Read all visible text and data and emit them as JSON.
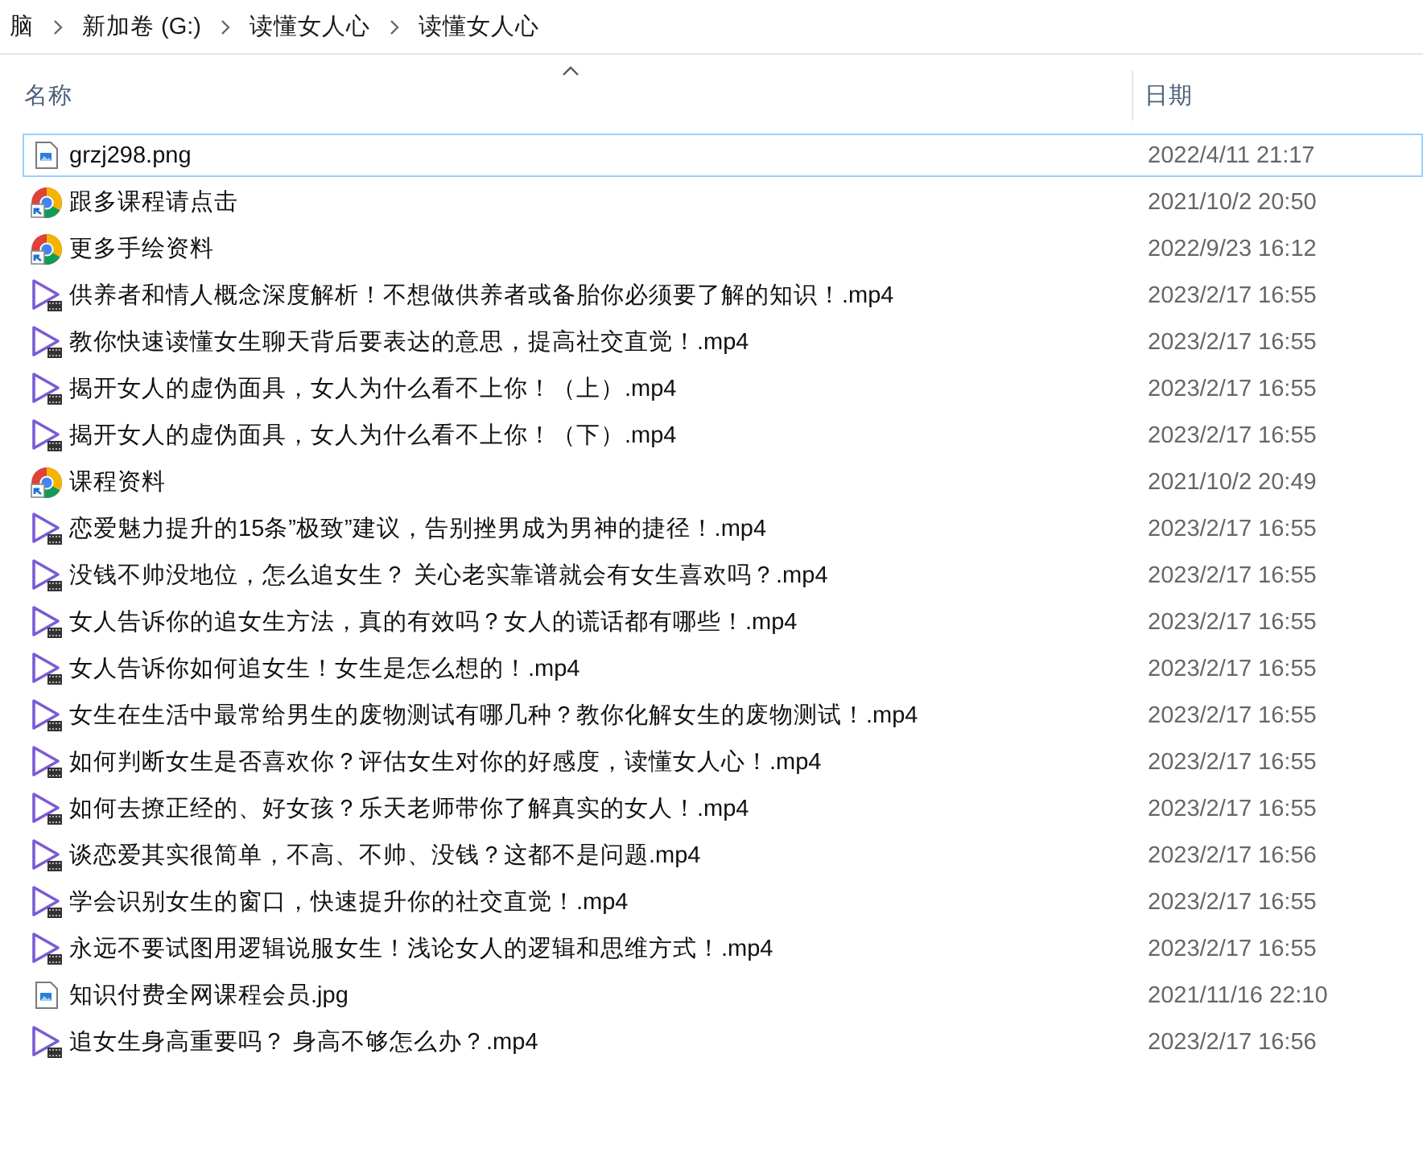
{
  "breadcrumb": [
    "脑",
    "新加卷 (G:)",
    "读懂女人心",
    "读懂女人心"
  ],
  "columns": [
    {
      "label": "名称",
      "sorted": true
    },
    {
      "label": "日期",
      "sorted": false
    }
  ],
  "files": [
    {
      "kind": "image",
      "name": "grzj298.png",
      "date": "2022/4/11 21:17",
      "focused": true
    },
    {
      "kind": "shortcut",
      "name": "跟多课程请点击",
      "date": "2021/10/2 20:50",
      "focused": false
    },
    {
      "kind": "shortcut",
      "name": "更多手绘资料",
      "date": "2022/9/23 16:12",
      "focused": false
    },
    {
      "kind": "video",
      "name": "供养者和情人概念深度解析！不想做供养者或备胎你必须要了解的知识！.mp4",
      "date": "2023/2/17 16:55",
      "focused": false
    },
    {
      "kind": "video",
      "name": "教你快速读懂女生聊天背后要表达的意思，提高社交直觉！.mp4",
      "date": "2023/2/17 16:55",
      "focused": false
    },
    {
      "kind": "video",
      "name": "揭开女人的虚伪面具，女人为什么看不上你！（上）.mp4",
      "date": "2023/2/17 16:55",
      "focused": false
    },
    {
      "kind": "video",
      "name": "揭开女人的虚伪面具，女人为什么看不上你！（下）.mp4",
      "date": "2023/2/17 16:55",
      "focused": false
    },
    {
      "kind": "shortcut",
      "name": "课程资料",
      "date": "2021/10/2 20:49",
      "focused": false
    },
    {
      "kind": "video",
      "name": "恋爱魅力提升的15条”极致”建议，告别挫男成为男神的捷径！.mp4",
      "date": "2023/2/17 16:55",
      "focused": false
    },
    {
      "kind": "video",
      "name": "没钱不帅没地位，怎么追女生？ 关心老实靠谱就会有女生喜欢吗？.mp4",
      "date": "2023/2/17 16:55",
      "focused": false
    },
    {
      "kind": "video",
      "name": "女人告诉你的追女生方法，真的有效吗？女人的谎话都有哪些！.mp4",
      "date": "2023/2/17 16:55",
      "focused": false
    },
    {
      "kind": "video",
      "name": "女人告诉你如何追女生！女生是怎么想的！.mp4",
      "date": "2023/2/17 16:55",
      "focused": false
    },
    {
      "kind": "video",
      "name": "女生在生活中最常给男生的废物测试有哪几种？教你化解女生的废物测试！.mp4",
      "date": "2023/2/17 16:55",
      "focused": false
    },
    {
      "kind": "video",
      "name": "如何判断女生是否喜欢你？评估女生对你的好感度，读懂女人心！.mp4",
      "date": "2023/2/17 16:55",
      "focused": false
    },
    {
      "kind": "video",
      "name": "如何去撩正经的、好女孩？乐天老师带你了解真实的女人！.mp4",
      "date": "2023/2/17 16:55",
      "focused": false
    },
    {
      "kind": "video",
      "name": "谈恋爱其实很简单，不高、不帅、没钱？这都不是问题.mp4",
      "date": "2023/2/17 16:56",
      "focused": false
    },
    {
      "kind": "video",
      "name": "学会识别女生的窗口，快速提升你的社交直觉！.mp4",
      "date": "2023/2/17 16:55",
      "focused": false
    },
    {
      "kind": "video",
      "name": "永远不要试图用逻辑说服女生！浅论女人的逻辑和思维方式！.mp4",
      "date": "2023/2/17 16:55",
      "focused": false
    },
    {
      "kind": "image",
      "name": "知识付费全网课程会员.jpg",
      "date": "2021/11/16 22:10",
      "focused": false
    },
    {
      "kind": "video",
      "name": "追女生身高重要吗？ 身高不够怎么办？.mp4",
      "date": "2023/2/17 16:56",
      "focused": false
    }
  ]
}
